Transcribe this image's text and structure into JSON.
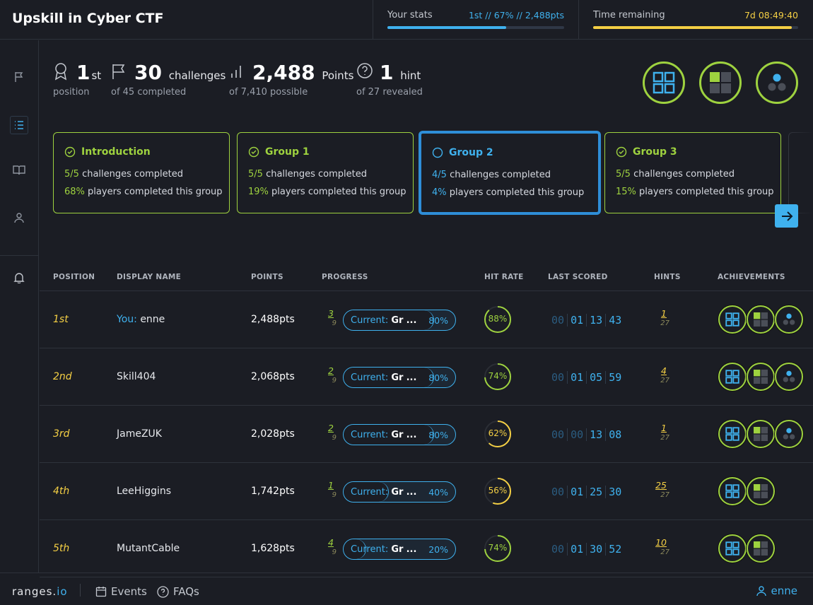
{
  "header": {
    "title": "Upskill in Cyber CTF",
    "your_stats_label": "Your stats",
    "your_stats_value": "1st // 67% // 2,488pts",
    "your_stats_progress": 0.67,
    "time_label": "Time remaining",
    "time_value": "7d 08:49:40",
    "time_progress": 0.97
  },
  "stats": {
    "position": {
      "value": "1",
      "suffix": "st",
      "sub": "position"
    },
    "challenges": {
      "value": "30",
      "word": "challenges",
      "sub": "of 45 completed"
    },
    "points": {
      "value": "2,488",
      "word": "Points",
      "sub": "of 7,410 possible"
    },
    "hints": {
      "value": "1",
      "word": "hint",
      "sub": "of 27 revealed"
    }
  },
  "groups": [
    {
      "name": "Introduction",
      "done": "5/5",
      "done_text": "challenges completed",
      "pct": "68%",
      "pct_text": "players completed this group"
    },
    {
      "name": "Group 1",
      "done": "5/5",
      "done_text": "challenges completed",
      "pct": "19%",
      "pct_text": "players completed this group"
    },
    {
      "name": "Group 2",
      "done": "4/5",
      "done_text": "challenges completed",
      "pct": "4%",
      "pct_text": "players completed this group"
    },
    {
      "name": "Group 3",
      "done": "5/5",
      "done_text": "challenges completed",
      "pct": "15%",
      "pct_text": "players completed this group"
    }
  ],
  "table": {
    "headers": [
      "POSITION",
      "DISPLAY NAME",
      "POINTS",
      "PROGRESS",
      "HIT RATE",
      "LAST SCORED",
      "HINTS",
      "ACHIEVEMENTS"
    ],
    "current_label": "Current:",
    "current_group": "Gr",
    "ellipsis": "...",
    "rows": [
      {
        "pos": "1st",
        "you": "You:",
        "name": "enne",
        "points": "2,488pts",
        "prog_a": "3",
        "prog_b": "9",
        "prog_pct": "80%",
        "prog_val": 0.8,
        "hit": "88%",
        "hit_val": 0.88,
        "last": [
          "00",
          "01",
          "13",
          "43"
        ],
        "hint_a": "1",
        "hint_b": "27",
        "achievements": 3
      },
      {
        "pos": "2nd",
        "you": "",
        "name": "Skill404",
        "points": "2,068pts",
        "prog_a": "2",
        "prog_b": "9",
        "prog_pct": "80%",
        "prog_val": 0.8,
        "hit": "74%",
        "hit_val": 0.74,
        "last": [
          "00",
          "01",
          "05",
          "59"
        ],
        "hint_a": "4",
        "hint_b": "27",
        "achievements": 3
      },
      {
        "pos": "3rd",
        "you": "",
        "name": "JameZUK",
        "points": "2,028pts",
        "prog_a": "2",
        "prog_b": "9",
        "prog_pct": "80%",
        "prog_val": 0.8,
        "hit": "62%",
        "hit_val": 0.62,
        "last": [
          "00",
          "00",
          "13",
          "08"
        ],
        "hint_a": "1",
        "hint_b": "27",
        "achievements": 3
      },
      {
        "pos": "4th",
        "you": "",
        "name": "LeeHiggins",
        "points": "1,742pts",
        "prog_a": "1",
        "prog_b": "9",
        "prog_pct": "40%",
        "prog_val": 0.4,
        "hit": "56%",
        "hit_val": 0.56,
        "last": [
          "00",
          "01",
          "25",
          "30"
        ],
        "hint_a": "25",
        "hint_b": "27",
        "achievements": 2
      },
      {
        "pos": "5th",
        "you": "",
        "name": "MutantCable",
        "points": "1,628pts",
        "prog_a": "4",
        "prog_b": "9",
        "prog_pct": "20%",
        "prog_val": 0.2,
        "hit": "74%",
        "hit_val": 0.74,
        "last": [
          "00",
          "01",
          "30",
          "52"
        ],
        "hint_a": "10",
        "hint_b": "27",
        "achievements": 2
      }
    ]
  },
  "footer": {
    "brand_main": "ranges.",
    "brand_tld": "io",
    "events": "Events",
    "faqs": "FAQs",
    "user": "enne"
  },
  "colors": {
    "accent": "#3fb1ee",
    "success": "#9ed23f",
    "warning": "#f4cf44"
  }
}
